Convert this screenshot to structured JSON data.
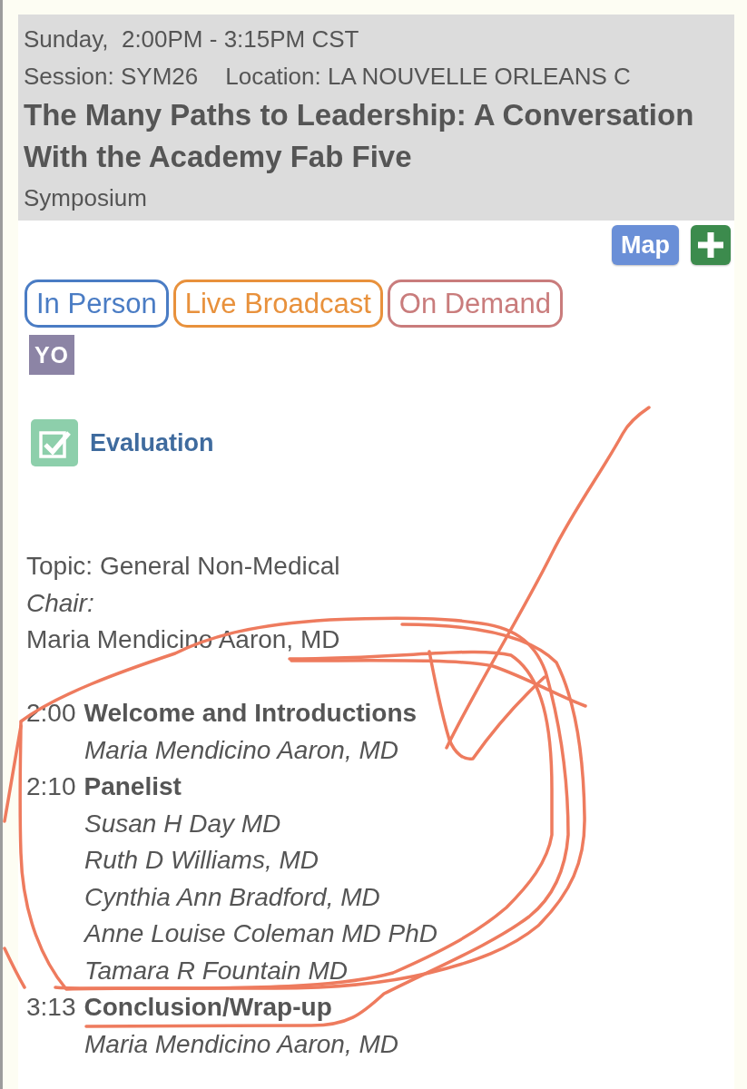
{
  "session": {
    "time": "Sunday,  2:00PM - 3:15PM CST",
    "code": "Session: SYM26",
    "location": "Location: LA NOUVELLE ORLEANS C",
    "title": "The Many Paths to Leadership: A Conversation With the Academy Fab Five",
    "type": "Symposium"
  },
  "actions": [
    {
      "kind": "label",
      "label": "Map"
    },
    {
      "kind": "add"
    }
  ],
  "formats": [
    {
      "label": "In Person",
      "color": "#4a7cc4"
    },
    {
      "label": "Live Broadcast",
      "color": "#e8913c"
    },
    {
      "label": "On Demand",
      "color": "#c97c7c"
    }
  ],
  "track_badge": "YO",
  "evaluation": "Evaluation",
  "details": {
    "topic": "Topic: General Non-Medical",
    "chair_label": "Chair:",
    "chair": "Maria Mendicino Aaron, MD"
  },
  "agenda": [
    {
      "time": "2:00",
      "title": "Welcome and Introductions",
      "speakers": [
        "Maria Mendicino Aaron, MD"
      ]
    },
    {
      "time": "2:10",
      "title": "Panelist",
      "speakers": [
        "Susan H Day MD",
        "Ruth D Williams, MD",
        "Cynthia Ann Bradford, MD",
        "Anne Louise Coleman MD PhD",
        "Tamara R Fountain MD"
      ]
    },
    {
      "time": "3:13",
      "title": "Conclusion/Wrap-up",
      "speakers": [
        "Maria Mendicino Aaron, MD"
      ]
    }
  ],
  "annotations": {
    "circle": true,
    "arrow": true
  }
}
